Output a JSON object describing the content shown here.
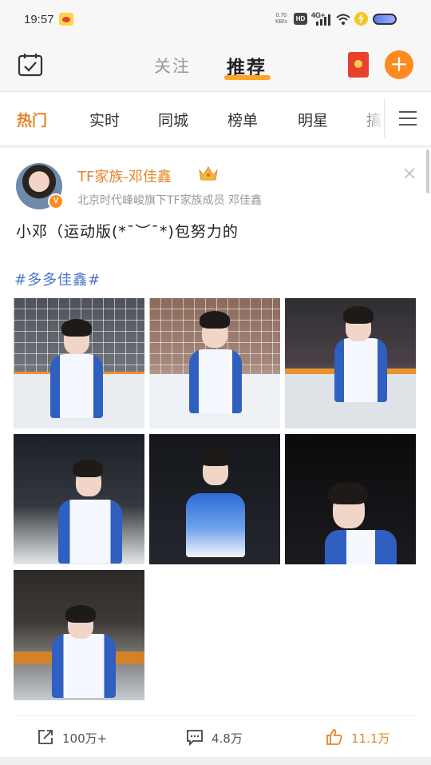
{
  "status_bar": {
    "time": "19:57",
    "net_speed_value": "0.70",
    "net_speed_unit": "KB/s",
    "hd": "HD",
    "network": "4G+"
  },
  "header": {
    "tabs": [
      {
        "label": "关注",
        "active": false
      },
      {
        "label": "推荐",
        "active": true
      }
    ],
    "accent_color": "#ffa526",
    "add_label": "+"
  },
  "channels": {
    "items": [
      "热门",
      "实时",
      "同城",
      "榜单",
      "明星",
      "搞"
    ],
    "active_index": 0,
    "active_color": "#e6862a"
  },
  "post": {
    "author": "TF家族-邓佳鑫",
    "verified_badge": "V",
    "author_subtitle": "北京时代峰峻旗下TF家族成员 邓佳鑫",
    "text": "小邓（运动版(*¯︶¯*)包努力的",
    "hashtag": "#多多佳鑫#",
    "images_count": 7,
    "actions": {
      "repost": "100万+",
      "comment": "4.8万",
      "like": "11.1万"
    },
    "icons": [
      "share-icon",
      "comment-icon",
      "like-icon",
      "crown-icon",
      "close-icon"
    ]
  }
}
